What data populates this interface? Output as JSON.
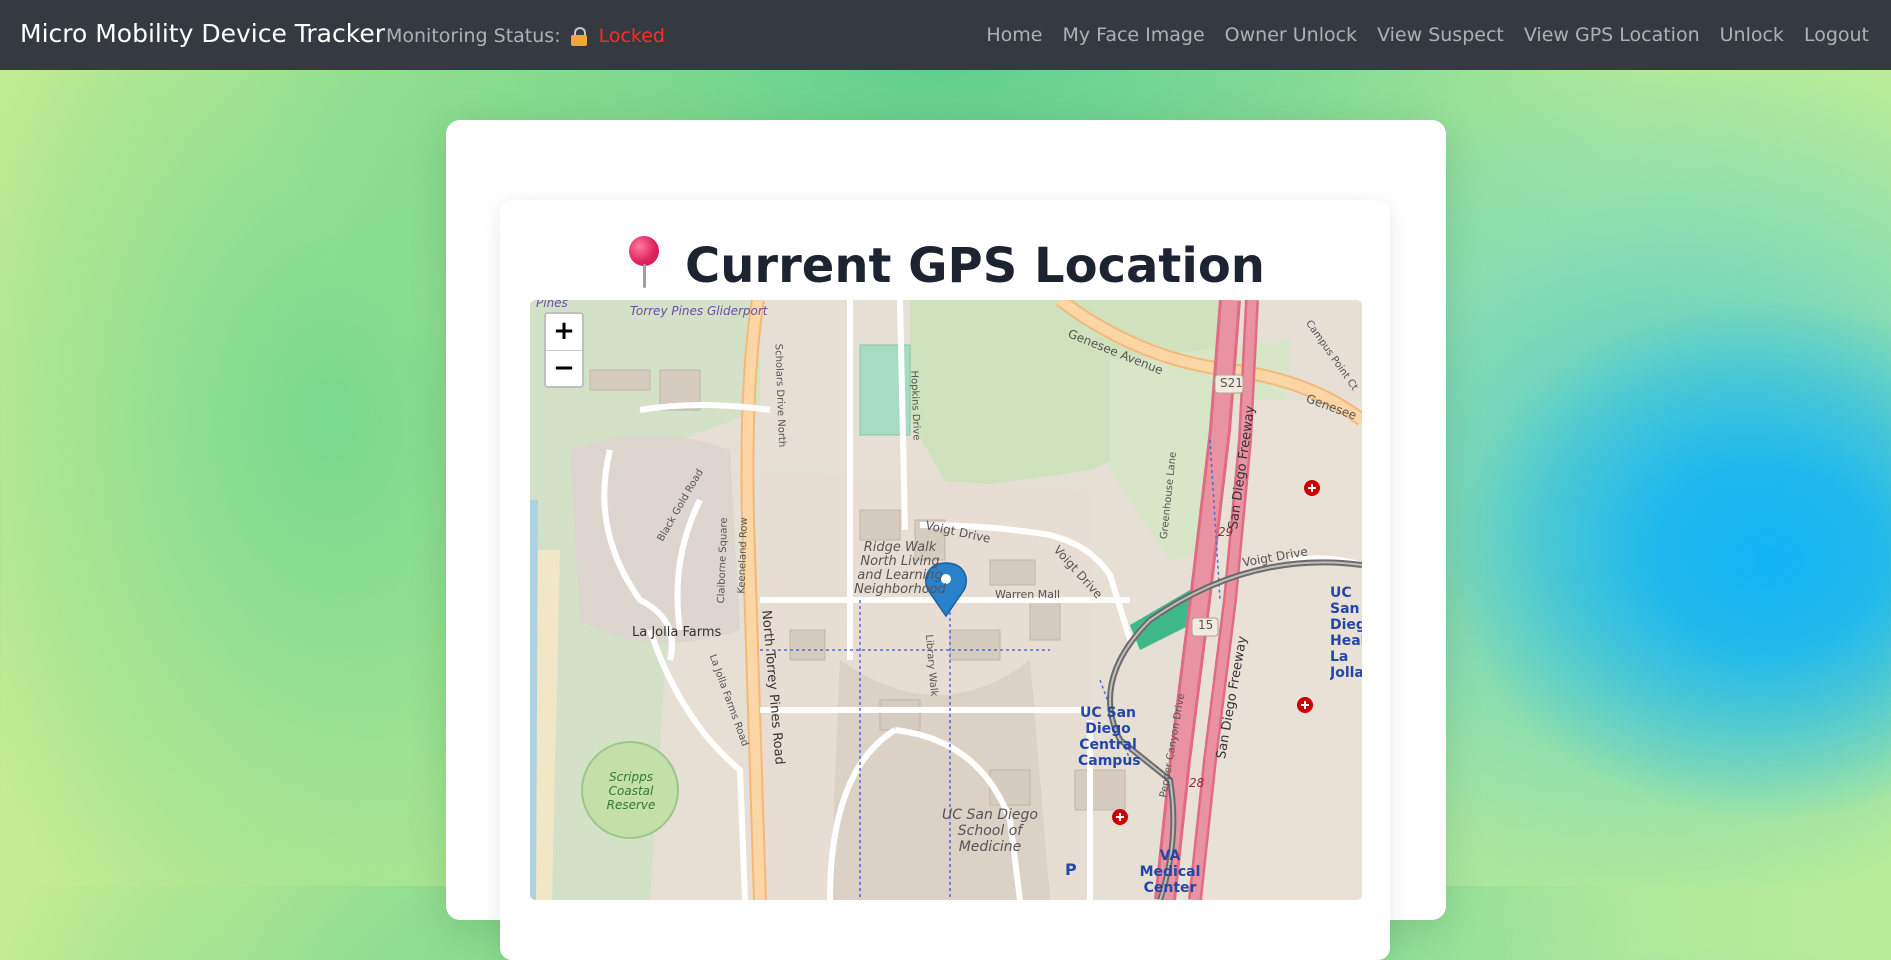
{
  "navbar": {
    "brand": "Micro Mobility Device Tracker",
    "status_label": "Monitoring Status:",
    "status_value": "Locked",
    "status_icon": "lock-icon",
    "links": [
      "Home",
      "My Face Image",
      "Owner Unlock",
      "View Suspect",
      "View GPS Location",
      "Unlock",
      "Logout"
    ]
  },
  "page": {
    "title": "Current GPS Location",
    "title_icon": "round-pushpin-icon"
  },
  "map": {
    "zoom_in": "+",
    "zoom_out": "−",
    "marker_icon": "map-marker-icon",
    "labels": {
      "glider": "Torrey Pines Gliderport",
      "pines": "Pines",
      "genesee": "Genesee Avenue",
      "genesee2": "Genesee",
      "s21": "S21",
      "campus_point": "Campus Point Ct",
      "scholars": "Scholars Drive North",
      "hopkins": "Hopkins Drive",
      "black_gold": "Black Gold Road",
      "claiborne": "Claiborne Square",
      "keeneland": "Keeneland Row",
      "voigt": "Voigt Drive",
      "voigt2": "Voigt Drive",
      "voigt3": "Voigt Drive",
      "ridge_walk": "Ridge Walk North Living and Learning Neighborhood",
      "warren_mall": "Warren Mall",
      "la_jolla_farms": "La Jolla Farms",
      "la_jolla_farms_road": "La Jolla Farms Road",
      "north_torrey": "North Torrey Pines Road",
      "library_walk": "Library Walk",
      "greenhouse": "Greenhouse Lane",
      "san_diego_fwy": "San Diego Freeway",
      "san_diego_fwy2": "San Diego Freeway",
      "i15": "15",
      "r29": "29",
      "r28": "28",
      "pepper_canyon": "Pepper Canyon Drive",
      "uc_central": "UC San Diego Central Campus",
      "uc_health": "UC San Diego Health La Jolla",
      "scripps": "Scripps Coastal Reserve",
      "medicine": "UC San Diego School of Medicine",
      "va": "VA Medical Center",
      "parking": "P"
    }
  },
  "colors": {
    "navbar": "#343a40",
    "status_locked": "#ff2b2b",
    "marker": "#2a81cb",
    "freeway": "#e892a2",
    "primary_road": "#fcd6a4"
  }
}
